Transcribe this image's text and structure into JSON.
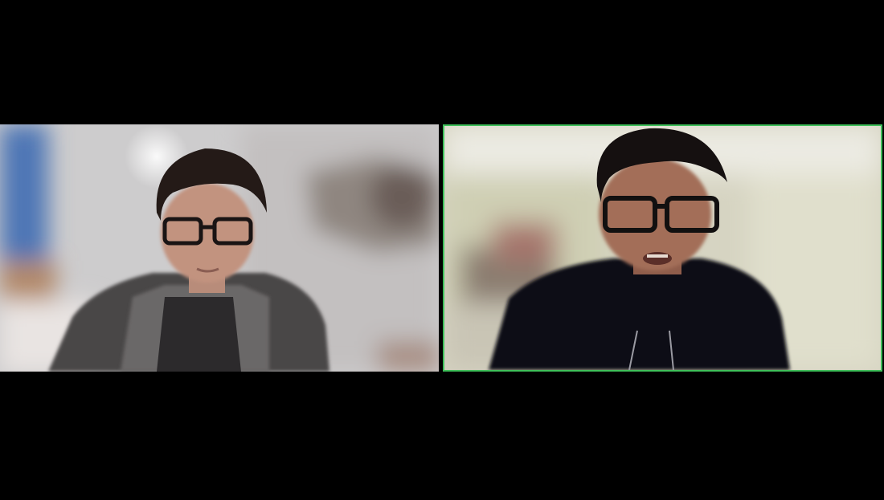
{
  "window": {
    "layout": "gallery-view",
    "background_color": "#000000"
  },
  "participants": [
    {
      "id": "participant-1",
      "speaking": false,
      "description_icon": "video-feed"
    },
    {
      "id": "participant-2",
      "speaking": true,
      "highlight_color": "#3fbf5a",
      "description_icon": "video-feed"
    }
  ]
}
